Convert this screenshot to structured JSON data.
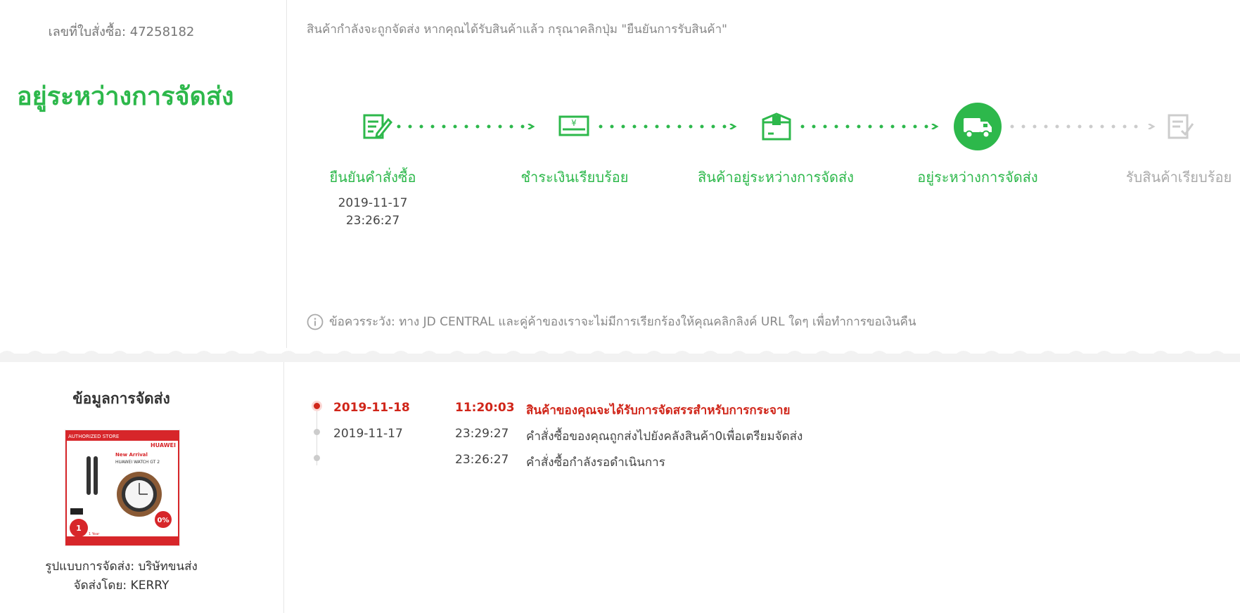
{
  "order": {
    "number_label": "เลขที่ใบสั่งซื้อ: 47258182",
    "status_title": "อยู่ระหว่างการจัดส่ง",
    "notice": "สินค้ากำลังจะถูกจัดส่ง หากคุณได้รับสินค้าแล้ว กรุณาคลิกปุ่ม \"ยืนยันการรับสินค้า\""
  },
  "steps": [
    {
      "label": "ยืนยันคำสั่งซื้อ",
      "icon": "order-confirm-icon",
      "date": "2019-11-17",
      "time": "23:26:27",
      "state": "done"
    },
    {
      "label": "ชำระเงินเรียบร้อย",
      "icon": "payment-card-icon",
      "state": "done"
    },
    {
      "label": "สินค้าอยู่ระหว่างการจัดส่ง",
      "icon": "package-box-icon",
      "state": "done"
    },
    {
      "label": "อยู่ระหว่างการจัดส่ง",
      "icon": "delivery-truck-icon",
      "state": "current"
    },
    {
      "label": "รับสินค้าเรียบร้อย",
      "icon": "receipt-check-icon",
      "state": "pending"
    }
  ],
  "warning": {
    "icon": "info-icon",
    "text": "ข้อควรระวัง: ทาง JD CENTRAL และคู่ค้าของเราจะไม่มีการเรียกร้องให้คุณคลิกลิงค์ URL ใดๆ เพื่อทำการขอเงินคืน"
  },
  "shipping": {
    "title": "ข้อมูลการจัดส่ง",
    "product_image": {
      "badge": "AUTHORIZED STORE",
      "brand": "HUAWEI",
      "headline": "New Arrival",
      "product": "HUAWEI WATCH GT 2",
      "offer": "0%",
      "warranty": "1 Year"
    },
    "method_label": "รูปแบบการจัดส่ง: บริษัทขนส่ง",
    "carrier_label": "จัดส่งโดย: KERRY"
  },
  "tracking": [
    {
      "date": "2019-11-18",
      "time": "11:20:03",
      "message": "สินค้าของคุณจะได้รับการจัดสรรสำหรับการกระจาย",
      "active": true
    },
    {
      "date": "2019-11-17",
      "time": "23:29:27",
      "message": "คำสั่งซื้อของคุณถูกส่งไปยังคลังสินค้า0เพื่อเตรียมจัดส่ง",
      "active": false
    },
    {
      "date": "",
      "time": "23:26:27",
      "message": "คำสั่งซื้อกำลังรอดำเนินการ",
      "active": false
    }
  ],
  "colors": {
    "green": "#2db84b",
    "red": "#d0261a",
    "gray": "#cccccc"
  }
}
